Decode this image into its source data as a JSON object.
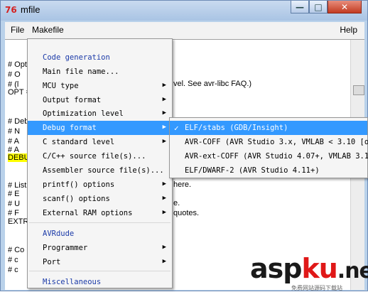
{
  "window": {
    "title": "mfile",
    "app_icon": "mfile-logo-icon"
  },
  "title_buttons": {
    "minimize": "—",
    "maximize": "□",
    "close": "✕"
  },
  "menubar": {
    "file": "File",
    "makefile": "Makefile",
    "help": "Help"
  },
  "editor_lines": [
    "# Opt",
    "#   O",
    "#   (l",
    "OPT =",
    "# Deb",
    "#   N",
    "#   A",
    "#   A",
    "DEBU",
    "# List",
    "#   E",
    "#   U",
    "#   F",
    "EXTR",
    "# Co",
    "#   c",
    "#   c"
  ],
  "editor_fragments": {
    "faq": "vel. See avr-libc FAQ.)",
    "here": "here.",
    "e": "e.",
    "quotes": "quotes."
  },
  "main_menu": [
    {
      "label": "Code generation",
      "heading": true
    },
    {
      "label": "Main file name..."
    },
    {
      "label": "MCU type",
      "submenu": true
    },
    {
      "label": "Output format",
      "submenu": true
    },
    {
      "label": "Optimization level",
      "submenu": true
    },
    {
      "label": "Debug format",
      "submenu": true,
      "selected": true
    },
    {
      "label": "C standard level",
      "submenu": true
    },
    {
      "label": "C/C++ source file(s)..."
    },
    {
      "label": "Assembler source file(s)..."
    },
    {
      "label": "printf() options",
      "submenu": true
    },
    {
      "label": "scanf() options",
      "submenu": true
    },
    {
      "label": "External RAM options",
      "submenu": true
    },
    {
      "label": "AVRdude",
      "heading": true
    },
    {
      "label": "Programmer",
      "submenu": true
    },
    {
      "label": "Port",
      "submenu": true
    },
    {
      "label": "Miscellaneous",
      "heading": true
    }
  ],
  "debug_submenu": [
    {
      "label": "ELF/stabs (GDB/Insight)",
      "checked": true,
      "selected": true
    },
    {
      "label": "AVR-COFF (AVR Studio 3.x, VMLAB < 3.10 [obs"
    },
    {
      "label": "AVR-ext-COFF (AVR Studio 4.07+, VMLAB 3.10+"
    },
    {
      "label": "ELF/DWARF-2 (AVR Studio 4.11+)"
    }
  ],
  "glyphs": {
    "submenu_arrow": "▶",
    "check": "✓"
  },
  "watermark": {
    "asp": "asp",
    "ku": "ku",
    "net": ".net",
    "sub": "免费网站源码下载站"
  },
  "colors": {
    "selection": "#3399ff",
    "heading": "#1b3aa8",
    "highlight": "#ffff00",
    "watermark_red": "#e01818"
  }
}
